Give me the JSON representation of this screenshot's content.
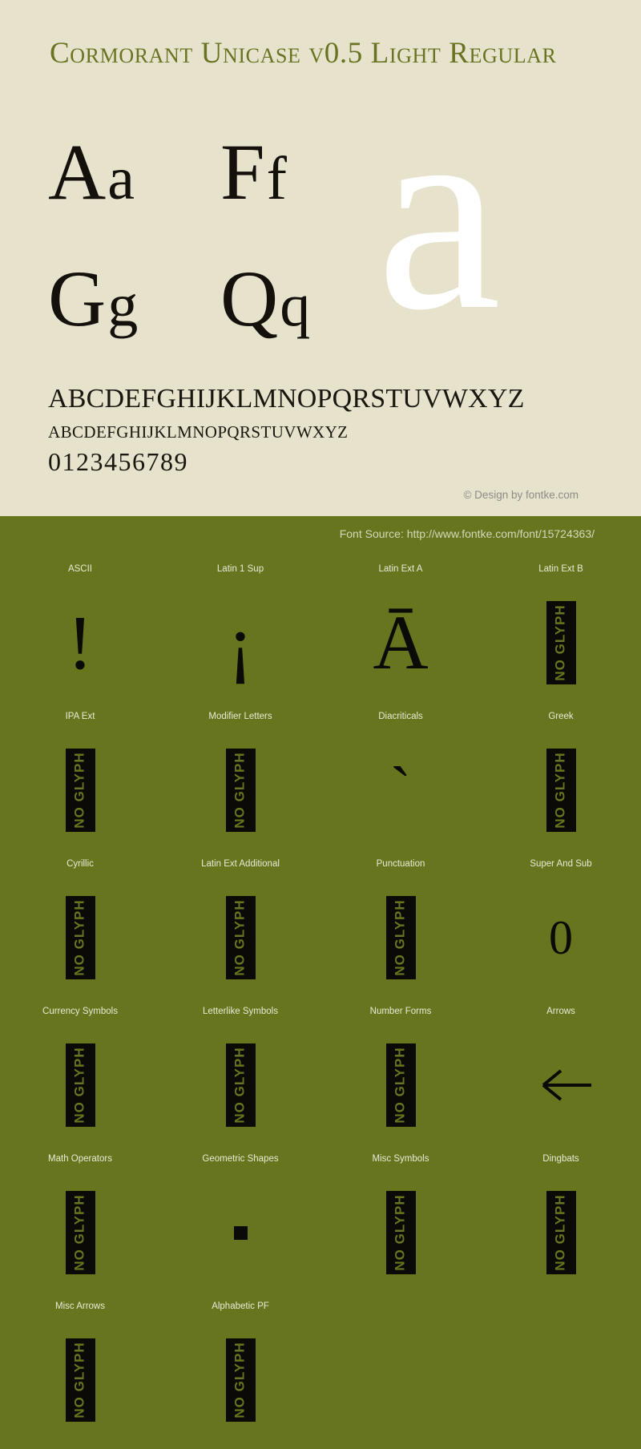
{
  "hero": {
    "title": "Cormorant Unicase v0.5 Light Regular",
    "big_glyph": "a",
    "sample_pairs": [
      {
        "upper": "A",
        "lower": "a"
      },
      {
        "upper": "F",
        "lower": "f"
      },
      {
        "upper": "G",
        "lower": "g"
      },
      {
        "upper": "Q",
        "lower": "q"
      }
    ],
    "alphabet_upper": "ABCDEFGHIJKLMNOPQRSTUVWXYZ",
    "alphabet_lower": "abcdefghijklmnopqrstuvwxyz",
    "digits": "0123456789",
    "credit": "© Design by fontke.com",
    "background_color": "#e7e2cb",
    "title_color": "#6a7322"
  },
  "blocks_section": {
    "source_line": "Font Source: http://www.fontke.com/font/15724363/",
    "background_color": "#67751e",
    "no_glyph_label": "NO GLYPH",
    "cells": [
      {
        "label": "ASCII",
        "sample": "!",
        "kind": "glyph",
        "size": "sz-big"
      },
      {
        "label": "Latin 1 Sup",
        "sample": "¡",
        "kind": "glyph",
        "size": "sz-big"
      },
      {
        "label": "Latin Ext A",
        "sample": "Ā",
        "kind": "glyph",
        "size": "sz-big"
      },
      {
        "label": "Latin Ext B",
        "sample": "",
        "kind": "noglyph",
        "size": ""
      },
      {
        "label": "IPA Ext",
        "sample": "",
        "kind": "noglyph",
        "size": ""
      },
      {
        "label": "Modifier Letters",
        "sample": "",
        "kind": "noglyph",
        "size": ""
      },
      {
        "label": "Diacriticals",
        "sample": "ˋ",
        "kind": "glyph",
        "size": "sz-mid"
      },
      {
        "label": "Greek",
        "sample": "",
        "kind": "noglyph",
        "size": ""
      },
      {
        "label": "Cyrillic",
        "sample": "",
        "kind": "noglyph",
        "size": ""
      },
      {
        "label": "Latin Ext Additional",
        "sample": "",
        "kind": "noglyph",
        "size": ""
      },
      {
        "label": "Punctuation",
        "sample": "",
        "kind": "noglyph",
        "size": ""
      },
      {
        "label": "Super And Sub",
        "sample": "0",
        "kind": "glyph",
        "size": "sz-small"
      },
      {
        "label": "Currency Symbols",
        "sample": "",
        "kind": "noglyph",
        "size": ""
      },
      {
        "label": "Letterlike Symbols",
        "sample": "",
        "kind": "noglyph",
        "size": ""
      },
      {
        "label": "Number Forms",
        "sample": "",
        "kind": "noglyph",
        "size": ""
      },
      {
        "label": "Arrows",
        "sample": "←",
        "kind": "arrow",
        "size": ""
      },
      {
        "label": "Math Operators",
        "sample": "",
        "kind": "noglyph",
        "size": ""
      },
      {
        "label": "Geometric Shapes",
        "sample": "■",
        "kind": "square",
        "size": ""
      },
      {
        "label": "Misc Symbols",
        "sample": "",
        "kind": "noglyph",
        "size": ""
      },
      {
        "label": "Dingbats",
        "sample": "",
        "kind": "noglyph",
        "size": ""
      },
      {
        "label": "Misc Arrows",
        "sample": "",
        "kind": "noglyph",
        "size": ""
      },
      {
        "label": "Alphabetic PF",
        "sample": "",
        "kind": "noglyph",
        "size": ""
      },
      {
        "label": "",
        "sample": "",
        "kind": "empty",
        "size": ""
      },
      {
        "label": "",
        "sample": "",
        "kind": "empty",
        "size": ""
      }
    ]
  }
}
